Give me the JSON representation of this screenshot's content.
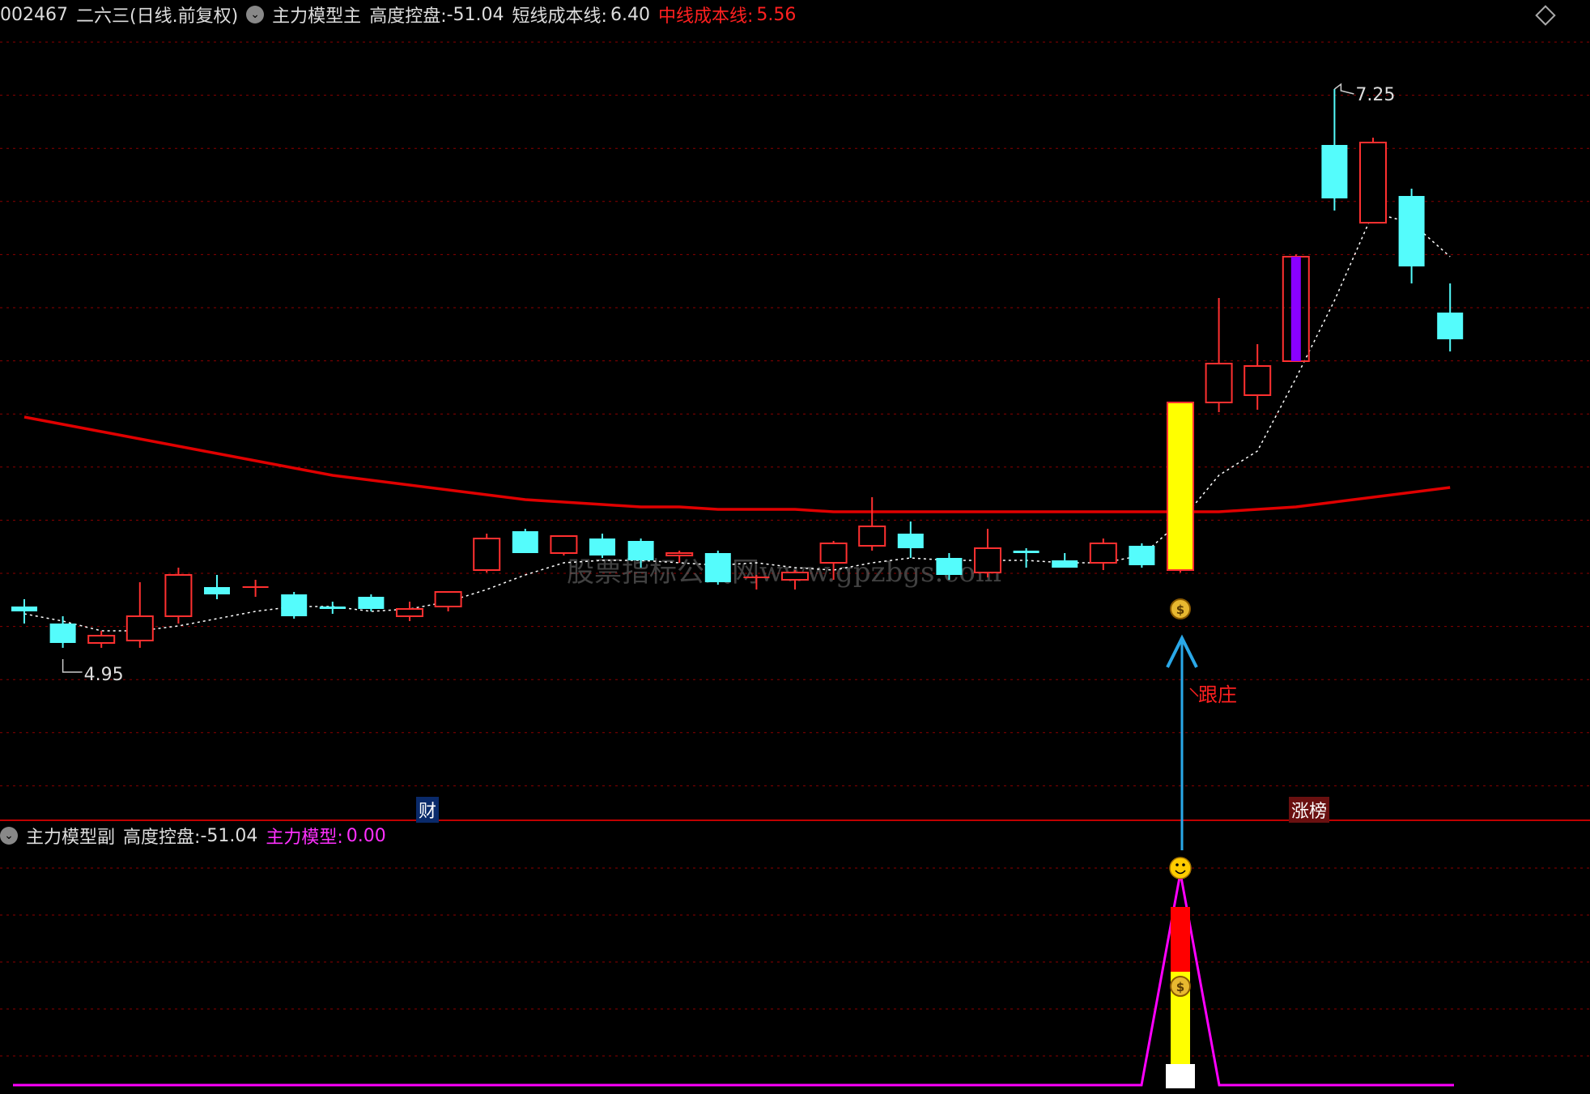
{
  "main_header": {
    "code": "002467",
    "name": "二六三",
    "period": "(日线.前复权)",
    "indicator": "主力模型主",
    "ctrl_label": "高度控盘:",
    "ctrl_value": "-51.04",
    "short_label": "短线成本线:",
    "short_value": "6.40",
    "mid_label": "中线成本线:",
    "mid_value": "5.56"
  },
  "sub_header": {
    "indicator": "主力模型副",
    "ctrl_label": "高度控盘:",
    "ctrl_value": "-51.04",
    "model_label": "主力模型:",
    "model_value": "0.00"
  },
  "annotations": {
    "high_label": "7.25",
    "low_label": "4.95",
    "follow_label": "跟庄",
    "finance_tag": "财",
    "limitup_tag": "涨榜",
    "watermark": "股票指标公式网www.gpzbgs.com"
  },
  "colors": {
    "up": "#ff3030",
    "down": "#54fcfc",
    "mid_line": "#e00000",
    "short_line": "#ffffff",
    "signal_bar": "#ffff00",
    "purple_bar": "#8a00ff",
    "model_line": "#ff00ff",
    "arrow": "#2aa8e8",
    "grid": "#8b0000"
  },
  "icons": [
    "money-bag-icon",
    "smiley-icon",
    "up-arrow-icon",
    "collapse-icon",
    "diamond-icon"
  ],
  "chart_data": [
    {
      "type": "candlestick",
      "series": [
        {
          "name": "K线",
          "ohlc": [
            [
              5.12,
              5.15,
              5.05,
              5.1
            ],
            [
              5.05,
              5.08,
              4.95,
              4.97
            ],
            [
              4.97,
              5.02,
              4.95,
              5.0
            ],
            [
              4.98,
              5.22,
              4.95,
              5.08
            ],
            [
              5.08,
              5.28,
              5.05,
              5.25
            ],
            [
              5.2,
              5.25,
              5.15,
              5.17
            ],
            [
              5.2,
              5.23,
              5.16,
              5.2
            ],
            [
              5.17,
              5.18,
              5.07,
              5.08
            ],
            [
              5.12,
              5.14,
              5.09,
              5.11
            ],
            [
              5.16,
              5.17,
              5.1,
              5.11
            ],
            [
              5.08,
              5.14,
              5.06,
              5.11
            ],
            [
              5.12,
              5.18,
              5.1,
              5.18
            ],
            [
              5.27,
              5.42,
              5.26,
              5.4
            ],
            [
              5.43,
              5.44,
              5.34,
              5.34
            ],
            [
              5.34,
              5.41,
              5.33,
              5.41
            ],
            [
              5.4,
              5.42,
              5.32,
              5.33
            ],
            [
              5.39,
              5.4,
              5.28,
              5.31
            ],
            [
              5.33,
              5.35,
              5.3,
              5.34
            ],
            [
              5.34,
              5.35,
              5.21,
              5.22
            ],
            [
              5.24,
              5.25,
              5.19,
              5.24
            ],
            [
              5.23,
              5.27,
              5.19,
              5.26
            ],
            [
              5.3,
              5.39,
              5.23,
              5.38
            ],
            [
              5.37,
              5.57,
              5.35,
              5.45
            ],
            [
              5.42,
              5.47,
              5.32,
              5.36
            ],
            [
              5.32,
              5.34,
              5.23,
              5.25
            ],
            [
              5.26,
              5.44,
              5.24,
              5.36
            ],
            [
              5.35,
              5.36,
              5.28,
              5.34
            ],
            [
              5.31,
              5.34,
              5.28,
              5.28
            ],
            [
              5.3,
              5.4,
              5.27,
              5.38
            ],
            [
              5.37,
              5.38,
              5.28,
              5.29
            ],
            [
              5.27,
              5.96,
              5.26,
              5.96
            ],
            [
              5.96,
              6.39,
              5.92,
              6.12
            ],
            [
              5.99,
              6.2,
              5.93,
              6.11
            ],
            [
              6.13,
              6.57,
              6.13,
              6.56
            ],
            [
              7.02,
              7.25,
              6.75,
              6.8
            ],
            [
              6.7,
              7.05,
              6.7,
              7.03
            ],
            [
              6.81,
              6.84,
              6.45,
              6.52
            ],
            [
              6.33,
              6.45,
              6.17,
              6.22
            ]
          ]
        },
        {
          "name": "中线成本线",
          "values": [
            5.9,
            5.87,
            5.84,
            5.81,
            5.78,
            5.75,
            5.72,
            5.69,
            5.66,
            5.64,
            5.62,
            5.6,
            5.58,
            5.56,
            5.55,
            5.54,
            5.53,
            5.53,
            5.52,
            5.52,
            5.52,
            5.51,
            5.51,
            5.51,
            5.51,
            5.51,
            5.51,
            5.51,
            5.51,
            5.51,
            5.51,
            5.51,
            5.52,
            5.53,
            5.55,
            5.57,
            5.59,
            5.61
          ]
        },
        {
          "name": "短线成本线",
          "values": [
            5.09,
            5.06,
            5.02,
            5.02,
            5.04,
            5.07,
            5.1,
            5.12,
            5.12,
            5.1,
            5.11,
            5.14,
            5.19,
            5.25,
            5.3,
            5.31,
            5.31,
            5.3,
            5.29,
            5.3,
            5.28,
            5.27,
            5.3,
            5.32,
            5.31,
            5.31,
            5.31,
            5.3,
            5.3,
            5.33,
            5.47,
            5.66,
            5.76,
            6.06,
            6.38,
            6.74,
            6.7,
            6.56
          ]
        }
      ],
      "signal_bar_index": 30,
      "purple_bar_index": 33,
      "high": 7.25,
      "low": 4.95
    },
    {
      "type": "line",
      "series": [
        {
          "name": "主力模型",
          "values": [
            0,
            0,
            0,
            0,
            0,
            0,
            0,
            0,
            0,
            0,
            0,
            0,
            0,
            0,
            0,
            0,
            0,
            0,
            0,
            0,
            0,
            0,
            0,
            0,
            0,
            0,
            0,
            0,
            0,
            0,
            100,
            0,
            0,
            0,
            0,
            0,
            0,
            0
          ]
        }
      ],
      "signal_index": 30
    }
  ]
}
